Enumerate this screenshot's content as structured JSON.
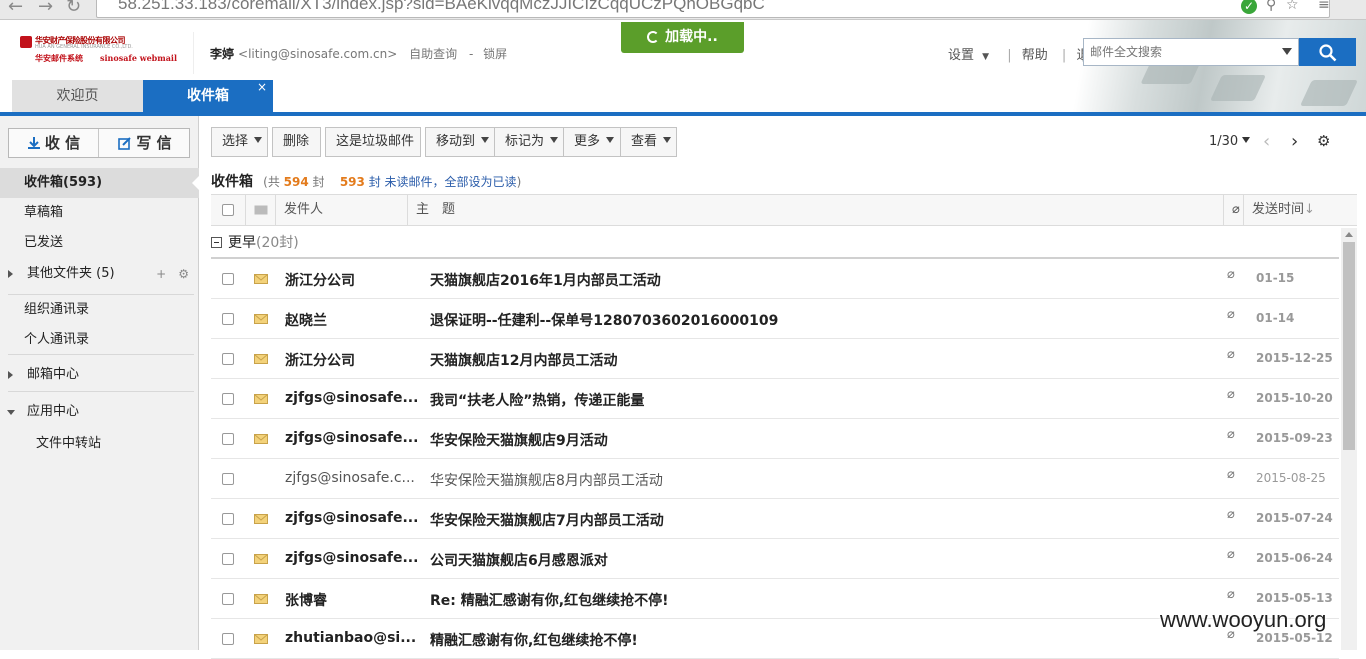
{
  "browser": {
    "url": "58.251.33.183/coremail/XT3/index.jsp?sid=BAeKivqqMczJJICIzCqqUCzPQhOBGqbC"
  },
  "header": {
    "logo_cn": "华安财产保险股份有限公司",
    "logo_en": "HUA AN GENERAL INSURANCE CO.,LTD.",
    "logo_sub_cn": "华安邮件系统",
    "logo_sub_en": "sinosafe webmail",
    "user_name": "李婷",
    "user_email": "<liting@sinosafe.com.cn>",
    "self_query": "自助查询",
    "dash": "-",
    "lock": "锁屏",
    "loading": "加载中..",
    "settings": "设置",
    "help": "帮助",
    "logout": "退出",
    "search_placeholder": "邮件全文搜索",
    "accent": "#1b6ec2"
  },
  "tabs": [
    {
      "label": "欢迎页"
    },
    {
      "label": "收件箱",
      "close": "×"
    }
  ],
  "sidebar": {
    "receive": "收 信",
    "compose": "写 信",
    "items": [
      {
        "label": "收件箱(593)"
      },
      {
        "label": "草稿箱"
      },
      {
        "label": "已发送"
      },
      {
        "label": "其他文件夹 (5)"
      },
      {
        "label": "组织通讯录"
      },
      {
        "label": "个人通讯录"
      },
      {
        "label": "邮箱中心"
      },
      {
        "label": "应用中心"
      },
      {
        "label": "文件中转站"
      }
    ],
    "plus": "+",
    "gear": "⚙"
  },
  "toolbar": {
    "select": "选择",
    "delete": "删除",
    "spam": "这是垃圾邮件",
    "move": "移动到",
    "mark": "标记为",
    "more": "更多",
    "view": "查看",
    "page": "1/30"
  },
  "list": {
    "title": "收件箱",
    "info_pre": "(共",
    "total": "594",
    "info_mid": "封",
    "unread": "593",
    "info_unread": "封 未读邮件",
    "mark_all": "，全部设为已读",
    "info_end": ")",
    "col_sender": "发件人",
    "col_subject": "主　题",
    "col_time": "发送时间",
    "group_label": "更早",
    "group_count": "(20封)"
  },
  "emails": [
    {
      "sender": "浙江分公司",
      "subject": "天猫旗舰店2016年1月内部员工活动",
      "date": "01-15"
    },
    {
      "sender": "赵晓兰",
      "subject": "退保证明--任建利--保单号1280703602016000109",
      "date": "01-14"
    },
    {
      "sender": "浙江分公司",
      "subject": "天猫旗舰店12月内部员工活动",
      "date": "2015-12-25"
    },
    {
      "sender": "zjfgs@sinosafe...",
      "subject": "我司“扶老人险”热销，传递正能量",
      "date": "2015-10-20"
    },
    {
      "sender": "zjfgs@sinosafe...",
      "subject": "华安保险天猫旗舰店9月活动",
      "date": "2015-09-23"
    },
    {
      "sender": "zjfgs@sinosafe.c...",
      "subject": "华安保险天猫旗舰店8月内部员工活动",
      "date": "2015-08-25"
    },
    {
      "sender": "zjfgs@sinosafe...",
      "subject": "华安保险天猫旗舰店7月内部员工活动",
      "date": "2015-07-24"
    },
    {
      "sender": "zjfgs@sinosafe...",
      "subject": "公司天猫旗舰店6月感恩派对",
      "date": "2015-06-24"
    },
    {
      "sender": "张博睿",
      "subject": "Re: 精融汇感谢有你,红包继续抢不停!",
      "date": "2015-05-13"
    },
    {
      "sender": "zhutianbao@si...",
      "subject": "精融汇感谢有你,红包继续抢不停!",
      "date": "2015-05-12"
    }
  ],
  "watermark": "www.wooyun.org"
}
